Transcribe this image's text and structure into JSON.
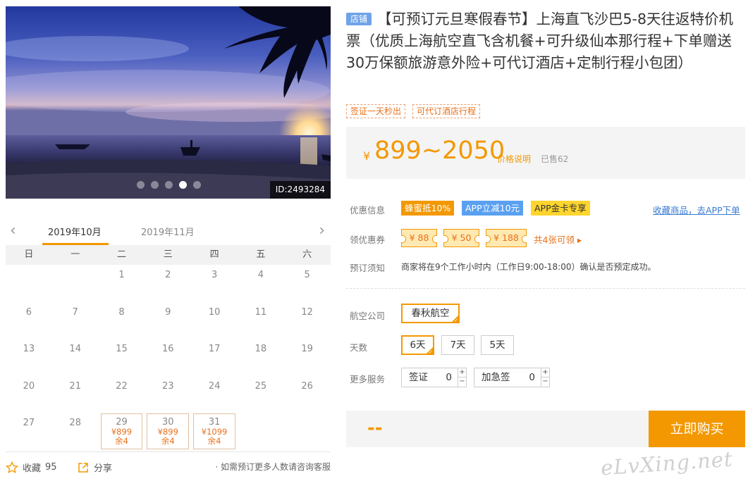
{
  "hero": {
    "image_id": "ID:2493284",
    "dots": 5,
    "active_dot": 3
  },
  "calendar": {
    "months": [
      "2019年10月",
      "2019年11月"
    ],
    "weekdays": [
      "日",
      "一",
      "二",
      "三",
      "四",
      "五",
      "六"
    ],
    "rows": [
      [
        {
          "d": ""
        },
        {
          "d": ""
        },
        {
          "d": "1"
        },
        {
          "d": "2"
        },
        {
          "d": "3"
        },
        {
          "d": "4"
        },
        {
          "d": "5"
        }
      ],
      [
        {
          "d": "6"
        },
        {
          "d": "7"
        },
        {
          "d": "8"
        },
        {
          "d": "9"
        },
        {
          "d": "10"
        },
        {
          "d": "11"
        },
        {
          "d": "12"
        }
      ],
      [
        {
          "d": "13"
        },
        {
          "d": "14"
        },
        {
          "d": "15"
        },
        {
          "d": "16"
        },
        {
          "d": "17"
        },
        {
          "d": "18"
        },
        {
          "d": "19"
        }
      ],
      [
        {
          "d": "20"
        },
        {
          "d": "21"
        },
        {
          "d": "22"
        },
        {
          "d": "23"
        },
        {
          "d": "24"
        },
        {
          "d": "25"
        },
        {
          "d": "26"
        }
      ],
      [
        {
          "d": "27"
        },
        {
          "d": "28"
        },
        {
          "d": "29",
          "price": "¥899",
          "left": "余4"
        },
        {
          "d": "30",
          "price": "¥899",
          "left": "余4"
        },
        {
          "d": "31",
          "price": "¥1099",
          "left": "余4"
        },
        {
          "d": "",
          "blank": true
        },
        {
          "d": "",
          "blank": true
        }
      ]
    ]
  },
  "actions": {
    "favorite_label": "收藏",
    "favorite_count": "95",
    "share_label": "分享",
    "consult": "· 如需预订更多人数请咨询客服"
  },
  "product": {
    "shop_badge": "店铺",
    "title": "【可预订元旦寒假春节】上海直飞沙巴5-8天往返特价机票（优质上海航空直飞含机餐+可升级仙本那行程+下单赠送30万保额旅游意外险+可代订酒店+定制行程小包团）",
    "tags": [
      "签证一天秒出",
      "可代订酒店行程"
    ],
    "price_currency": "¥",
    "price": "899~2050",
    "price_note": "价格说明",
    "sold": "已售62"
  },
  "offers": {
    "label": "优惠信息",
    "items": [
      "蜂蜜抵10%",
      "APP立减10元",
      "APP金卡专享"
    ],
    "fav_link": "收藏商品，去APP下单"
  },
  "coupons": {
    "label": "领优惠券",
    "items": [
      "¥ 88",
      "¥ 50",
      "¥ 188"
    ],
    "more": "共4张可领 ▸"
  },
  "booking": {
    "label": "预订须知",
    "notice": "商家将在9个工作小时内（工作日9:00-18:00）确认是否预定成功。"
  },
  "airline": {
    "label": "航空公司",
    "options": [
      "春秋航空"
    ],
    "selected": 0
  },
  "days": {
    "label": "天数",
    "options": [
      "6天",
      "7天",
      "5天"
    ],
    "selected": 0
  },
  "services": {
    "label": "更多服务",
    "items": [
      {
        "name": "签证",
        "count": "0"
      },
      {
        "name": "加急签",
        "count": "0"
      }
    ]
  },
  "buy": {
    "total": "--",
    "button": "立即购买"
  },
  "watermark": "eLvXing.net",
  "colors": {
    "accent": "#f39800",
    "price": "#f39800",
    "link": "#3a7ad4",
    "badge_blue": "#6fa3e8"
  }
}
